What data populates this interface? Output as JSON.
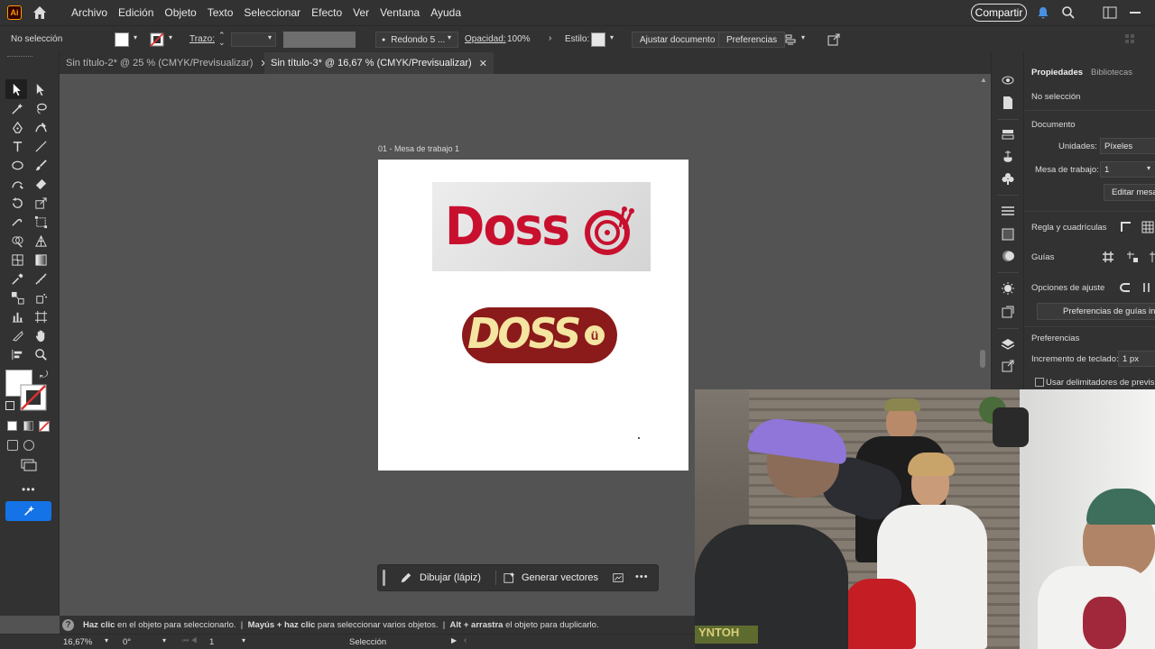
{
  "app": {
    "logo_text": "Ai"
  },
  "menu": {
    "items": [
      "Archivo",
      "Edición",
      "Objeto",
      "Texto",
      "Seleccionar",
      "Efecto",
      "Ver",
      "Ventana",
      "Ayuda"
    ],
    "share_label": "Compartir"
  },
  "control_bar": {
    "selection": "No selección",
    "stroke_label": "Trazo:",
    "brush_label": "Redondo 5 ...",
    "opacity_label": "Opacidad:",
    "opacity_value": "100%",
    "style_label": "Estilo:",
    "fit_button": "Ajustar documento",
    "prefs_button": "Preferencias"
  },
  "tabs": [
    {
      "label": "Sin título-2* @ 25 % (CMYK/Previsualizar)",
      "active": false
    },
    {
      "label": "Sin título-3* @ 16,67 % (CMYK/Previsualizar)",
      "active": true
    }
  ],
  "artboard": {
    "label": "01 - Mesa de trabajo 1",
    "logo1_text": "Doss",
    "logo2_text": "DOSS",
    "logo2_badge": "ü"
  },
  "context_bar": {
    "draw_button": "Dibujar (lápiz)",
    "vectors_button": "Generar vectores"
  },
  "panel": {
    "tab_props": "Propiedades",
    "tab_libs": "Bibliotecas",
    "no_selection": "No selección",
    "doc_heading": "Documento",
    "units_label": "Unidades:",
    "units_value": "Píxeles",
    "artboard_label": "Mesa de trabajo:",
    "artboard_value": "1",
    "edit_artboards": "Editar mesas",
    "rulers_label": "Regla y cuadrículas",
    "guides_label": "Guías",
    "snap_label": "Opciones de ajuste",
    "smart_guides_button": "Preferencias de guías inteli",
    "prefs_heading": "Preferencias",
    "keyboard_label": "Incremento de teclado:",
    "keyboard_value": "1 px",
    "preview_bounds": "Usar delimitadores de previsual"
  },
  "status": {
    "hint_b1": "Haz clic",
    "hint_t1": " en el objeto para seleccionarlo.  |  ",
    "hint_b2": "Mayús + haz clic",
    "hint_t2": " para seleccionar varios objetos.  |  ",
    "hint_b3": "Alt + arrastra",
    "hint_t3": " el objeto para duplicarlo."
  },
  "bottom_bar": {
    "zoom": "16,67%",
    "rotation": "0°",
    "artboard_num": "1",
    "mode": "Selección"
  },
  "webcam": {
    "shirt_text": "YNTOH"
  },
  "colors": {
    "logo_red": "#c8102e",
    "logo_maroon": "#8b1a1a",
    "logo_cream": "#f4e5a1",
    "accent_blue": "#1473e6"
  }
}
